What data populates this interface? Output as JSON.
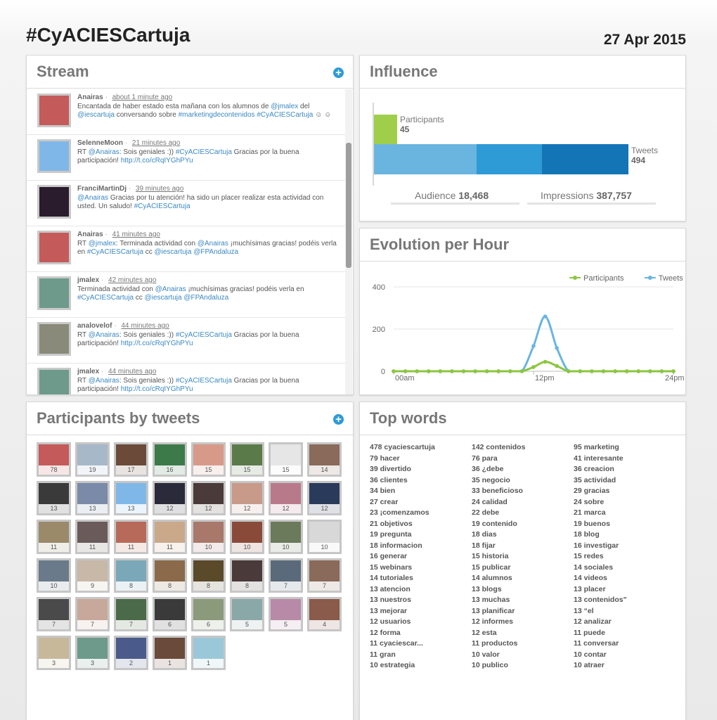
{
  "header": {
    "title": "#CyACIESCartuja",
    "date": "27 Apr 2015"
  },
  "stream": {
    "title": "Stream",
    "tweets": [
      {
        "user": "Anairas",
        "time": "about 1 minute ago",
        "color": "#c55a5a",
        "parts": [
          [
            "Encantada de haber estado esta mañana con los alumnos de ",
            0
          ],
          [
            "@jmalex",
            1
          ],
          [
            " del ",
            0
          ],
          [
            "@iescartuja",
            1
          ],
          [
            " conversando sobre ",
            0
          ],
          [
            "#marketingdecontenidos",
            1
          ],
          [
            " ",
            0
          ],
          [
            "#CyACIESCartuja",
            1
          ],
          [
            " ☺ ☺",
            0
          ]
        ]
      },
      {
        "user": "SelenneMoon",
        "time": "21 minutes ago",
        "color": "#7fb8e8",
        "parts": [
          [
            "RT ",
            0
          ],
          [
            "@Anairas",
            1
          ],
          [
            ": Sois geniales :)) ",
            0
          ],
          [
            "#CyACIESCartuja",
            1
          ],
          [
            " Gracias por la buena participación! ",
            0
          ],
          [
            "http://t.co/cRqIYGhPYu",
            1
          ]
        ]
      },
      {
        "user": "FranciMartinDj",
        "time": "39 minutes ago",
        "color": "#2a1c2c",
        "parts": [
          [
            "@Anairas",
            1
          ],
          [
            " Gracias por tu atención! ha sido un placer realizar esta actividad con usted. Un saludo! ",
            0
          ],
          [
            "#CyACIESCartuja",
            1
          ]
        ]
      },
      {
        "user": "Anairas",
        "time": "41 minutes ago",
        "color": "#c55a5a",
        "parts": [
          [
            "RT ",
            0
          ],
          [
            "@jmalex",
            1
          ],
          [
            ": Terminada actividad con ",
            0
          ],
          [
            "@Anairas",
            1
          ],
          [
            " ¡muchísimas gracias! podéis verla en ",
            0
          ],
          [
            "#CyACIESCartuja",
            1
          ],
          [
            " cc ",
            0
          ],
          [
            "@iescartuja",
            1
          ],
          [
            " ",
            0
          ],
          [
            "@FPAndaluza",
            1
          ]
        ]
      },
      {
        "user": "jmalex",
        "time": "42 minutes ago",
        "color": "#6d9a8a",
        "parts": [
          [
            "Terminada actividad con ",
            0
          ],
          [
            "@Anairas",
            1
          ],
          [
            " ¡muchísimas gracias! podéis verla en ",
            0
          ],
          [
            "#CyACIESCartuja",
            1
          ],
          [
            " cc ",
            0
          ],
          [
            "@iescartuja",
            1
          ],
          [
            " ",
            0
          ],
          [
            "@FPAndaluza",
            1
          ]
        ]
      },
      {
        "user": "analovelof",
        "time": "44 minutes ago",
        "color": "#8a8a7a",
        "parts": [
          [
            "RT ",
            0
          ],
          [
            "@Anairas",
            1
          ],
          [
            ": Sois geniales :)) ",
            0
          ],
          [
            "#CyACIESCartuja",
            1
          ],
          [
            " Gracias por la buena participación! ",
            0
          ],
          [
            "http://t.co/cRqIYGhPYu",
            1
          ]
        ]
      },
      {
        "user": "jmalex",
        "time": "44 minutes ago",
        "color": "#6d9a8a",
        "parts": [
          [
            "RT ",
            0
          ],
          [
            "@Anairas",
            1
          ],
          [
            ": Sois geniales :)) ",
            0
          ],
          [
            "#CyACIESCartuja",
            1
          ],
          [
            " Gracias por la buena participación! ",
            0
          ],
          [
            "http://t.co/cRqIYGhPYu",
            1
          ]
        ]
      }
    ]
  },
  "influence": {
    "title": "Influence",
    "participants_label": "Participants",
    "participants_value": "45",
    "tweets_label": "Tweets",
    "tweets_value": "494",
    "audience_label": "Audience",
    "audience_value": "18,468",
    "impressions_label": "Impressions",
    "impressions_value": "387,757"
  },
  "evolution": {
    "title": "Evolution per Hour",
    "chart_data": {
      "type": "line",
      "x": [
        "00am",
        "",
        "",
        "",
        "",
        "",
        "",
        "",
        "",
        "",
        "",
        "",
        "12pm",
        "",
        "",
        "",
        "",
        "",
        "",
        "",
        "",
        "",
        "",
        "",
        "24pm"
      ],
      "xticks": [
        "00am",
        "12pm",
        "24pm"
      ],
      "ylim": [
        0,
        400
      ],
      "yticks": [
        0,
        200,
        400
      ],
      "series": [
        {
          "name": "Participants",
          "color": "#8cc63f",
          "values": [
            0,
            0,
            0,
            0,
            0,
            0,
            0,
            0,
            0,
            0,
            0,
            0,
            20,
            45,
            25,
            0,
            0,
            0,
            0,
            0,
            0,
            0,
            0,
            0,
            0
          ]
        },
        {
          "name": "Tweets",
          "color": "#6ab5e0",
          "values": [
            0,
            0,
            0,
            0,
            0,
            0,
            0,
            0,
            0,
            0,
            0,
            0,
            120,
            260,
            110,
            0,
            0,
            0,
            0,
            0,
            0,
            0,
            0,
            0,
            0
          ]
        }
      ]
    }
  },
  "participants": {
    "title": "Participants by tweets",
    "counts": [
      "78",
      "19",
      "17",
      "16",
      "15",
      "15",
      "15",
      "14",
      "13",
      "13",
      "13",
      "12",
      "12",
      "12",
      "12",
      "12",
      "11",
      "11",
      "11",
      "11",
      "10",
      "10",
      "10",
      "10",
      "10",
      "9",
      "8",
      "8",
      "8",
      "8",
      "7",
      "7",
      "7",
      "7",
      "7",
      "6",
      "6",
      "5",
      "5",
      "4",
      "3",
      "3",
      "2",
      "1",
      "1"
    ],
    "colors": [
      "#c55a5a",
      "#a7b8c8",
      "#6b4a3a",
      "#3c7a4a",
      "#d89a88",
      "#5a7a4a",
      "#e6e6e6",
      "#8a6a5a",
      "#3a3a3a",
      "#7a8aa8",
      "#7fb8e8",
      "#2a2a3a",
      "#4a3a3a",
      "#c89a8a",
      "#b87a8a",
      "#2a3a5a",
      "#9a8a6a",
      "#6a5a5a",
      "#b86a5a",
      "#caa88a",
      "#a8786a",
      "#8a4a3a",
      "#6a7a5a",
      "#d8d8d8",
      "#6a7a8a",
      "#c8b8a8",
      "#7aa8b8",
      "#8a6a4a",
      "#5a4a2a",
      "#4a3a3a",
      "#5a6a7a",
      "#8a6a5a",
      "#4a4a4a",
      "#c8a89a",
      "#4a6a4a",
      "#3a3a3a",
      "#8a9a7a",
      "#8aa8a8",
      "#b88aa8",
      "#8a5a4a",
      "#c8b89a",
      "#6d9a8a",
      "#4a5a8a",
      "#6a4a3a",
      "#9ac8d8"
    ]
  },
  "topwords": {
    "title": "Top words",
    "col1": [
      "478 cyaciescartuja",
      "79 hacer",
      "39 divertido",
      "36 clientes",
      "34 bien",
      "27 crear",
      "23 ¡comenzamos",
      "21 objetivos",
      "19 pregunta",
      "18 informacion",
      "16 generar",
      "15 webinars",
      "14 tutoriales",
      "13 atencion",
      "13 nuestros",
      "13 mejorar",
      "12 usuarios",
      "12 forma",
      "11 cyaciescar...",
      "11 gran",
      "10 estrategia"
    ],
    "col2": [
      "142 contenidos",
      "76 para",
      "36 ¿debe",
      "35 negocio",
      "33 beneficioso",
      "24 calidad",
      "22 debe",
      "19 contenido",
      "18 dias",
      "18 fijar",
      "15 historia",
      "15 publicar",
      "14 alumnos",
      "13 blogs",
      "13 muchas",
      "13 planificar",
      "12 informes",
      "12 esta",
      "11 productos",
      "10 valor",
      "10 publico"
    ],
    "col3": [
      "95 marketing",
      "41 interesante",
      "36 creacion",
      "35 actividad",
      "29 gracias",
      "24 sobre",
      "21 marca",
      "19 buenos",
      "18 blog",
      "16 investigar",
      "15 redes",
      "14 sociales",
      "14 videos",
      "13 placer",
      "13 contenidos\"",
      "13 “el",
      "12 analizar",
      "11 puede",
      "11 conversar",
      "10 contar",
      "10 atraer"
    ]
  }
}
